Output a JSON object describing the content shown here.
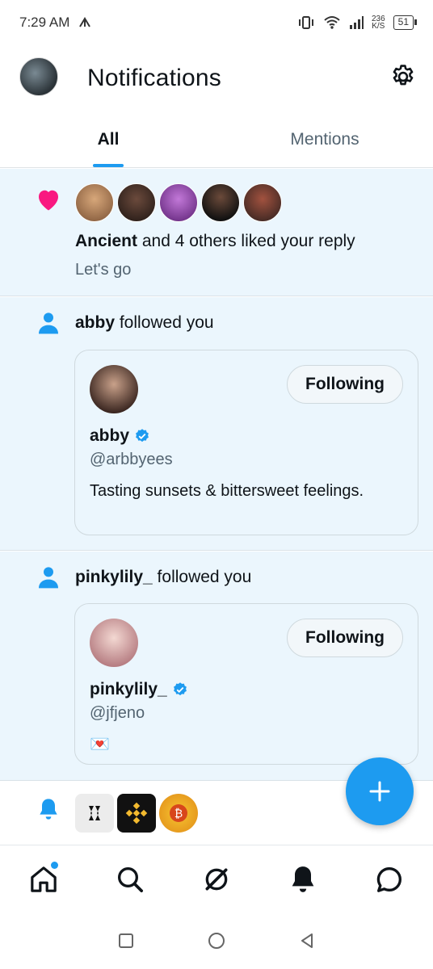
{
  "status_bar": {
    "time": "7:29 AM",
    "speed_value": "236",
    "speed_unit": "K/S",
    "battery": "51"
  },
  "header": {
    "title": "Notifications"
  },
  "tabs": [
    {
      "label": "All",
      "active": true
    },
    {
      "label": "Mentions",
      "active": false
    }
  ],
  "notifications": [
    {
      "type": "like",
      "actor": "Ancient",
      "action": " and 4 others liked your reply",
      "subtext": "Let's go",
      "avatar_colors": [
        "#b88c63",
        "#3a2a24",
        "#8a3fa8",
        "#2d2f34",
        "#4b3a36"
      ]
    },
    {
      "type": "follow",
      "actor": "abby",
      "action": " followed you",
      "card": {
        "name": "abby",
        "handle": "@arbbyees",
        "bio": "Tasting sunsets & bittersweet feelings.",
        "button": "Following",
        "pfp_color": "#5a3f35"
      }
    },
    {
      "type": "follow",
      "actor": "pinkylily_",
      "action": " followed you",
      "card": {
        "name": "pinkylily_",
        "handle": "@jfjeno",
        "bio": "💌",
        "button": "Following",
        "pfp_color": "#d8aeb3"
      }
    },
    {
      "type": "bell",
      "logo_colors": [
        "#e8e8e8",
        "#111111",
        "#f5a623"
      ]
    }
  ],
  "fab": {
    "icon": "plus-icon"
  },
  "bottom_nav": [
    "home-icon",
    "search-icon",
    "grok-icon",
    "notifications-icon",
    "messages-icon"
  ],
  "accent_color": "#1d9bf0"
}
